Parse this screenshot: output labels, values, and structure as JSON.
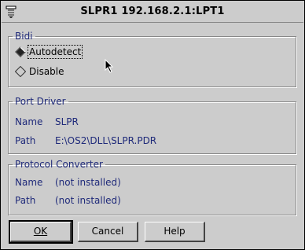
{
  "window": {
    "title": "SLPR1 192.168.2.1:LPT1"
  },
  "bidi": {
    "legend": "Bidi",
    "options": [
      {
        "label": "Autodetect",
        "selected": true
      },
      {
        "label": "Disable",
        "selected": false
      }
    ]
  },
  "port_driver": {
    "legend": "Port Driver",
    "name_label": "Name",
    "name_value": "SLPR",
    "path_label": "Path",
    "path_value": "E:\\OS2\\DLL\\SLPR.PDR"
  },
  "protocol_converter": {
    "legend": "Protocol Converter",
    "name_label": "Name",
    "name_value": "(not installed)",
    "path_label": "Path",
    "path_value": "(not installed)"
  },
  "buttons": {
    "ok": "OK",
    "cancel": "Cancel",
    "help": "Help"
  }
}
